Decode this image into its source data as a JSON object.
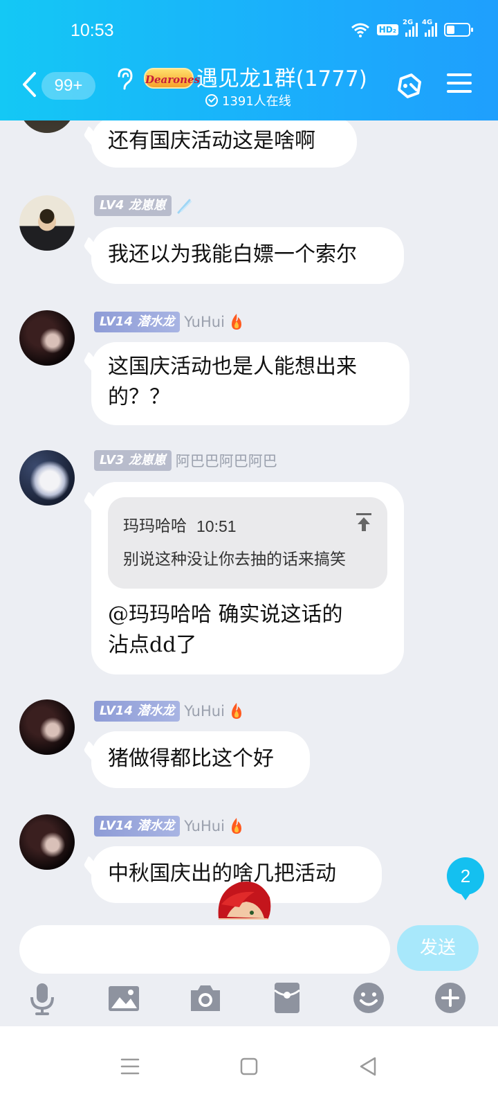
{
  "status_bar": {
    "time": "10:53",
    "hd_badge": "HD₂",
    "sim1_label": "2G",
    "sim2_label": "4G"
  },
  "header": {
    "unread_count": "99+",
    "group_logo_text": "Dearones",
    "group_title": "遇见龙1群(1777)",
    "online_text": "1391人在线"
  },
  "messages": [
    {
      "text": "还有国庆活动这是啥啊"
    },
    {
      "level": "LV4 龙崽崽",
      "nickname": "",
      "text": "我还以为我能白嫖一个索尔"
    },
    {
      "level": "LV14 潜水龙",
      "nickname": "YuHui",
      "text_line1": "这国庆活动也是人能想出来",
      "text_line2": "的？？"
    },
    {
      "level": "LV3 龙崽崽",
      "nickname": "阿巴巴阿巴阿巴",
      "quote_author": "玛玛哈哈",
      "quote_time": "10:51",
      "quote_text": "别说这种没让你去抽的话来搞笑",
      "text_line1": "@玛玛哈哈 确实说这话的",
      "text_line2": "沾点dd了"
    },
    {
      "level": "LV14 潜水龙",
      "nickname": "YuHui",
      "text": "猪做得都比这个好"
    },
    {
      "level": "LV14 潜水龙",
      "nickname": "YuHui",
      "text": "中秋国庆出的啥几把活动"
    }
  ],
  "new_message_count": "2",
  "input": {
    "placeholder": "",
    "send_label": "发送"
  },
  "colors": {
    "header_start": "#14c8f5",
    "header_end": "#1f9ffd",
    "send_disabled": "#a8e8fb",
    "badge": "#14c0f0"
  },
  "icons": [
    "back-icon",
    "ear-icon",
    "share-icon",
    "menu-icon",
    "fire-icon",
    "flag-icon",
    "quote-jump-icon",
    "microphone-icon",
    "image-icon",
    "camera-icon",
    "red-packet-icon",
    "emoji-icon",
    "plus-icon",
    "nav-menu-icon",
    "nav-home-icon",
    "nav-back-icon"
  ]
}
